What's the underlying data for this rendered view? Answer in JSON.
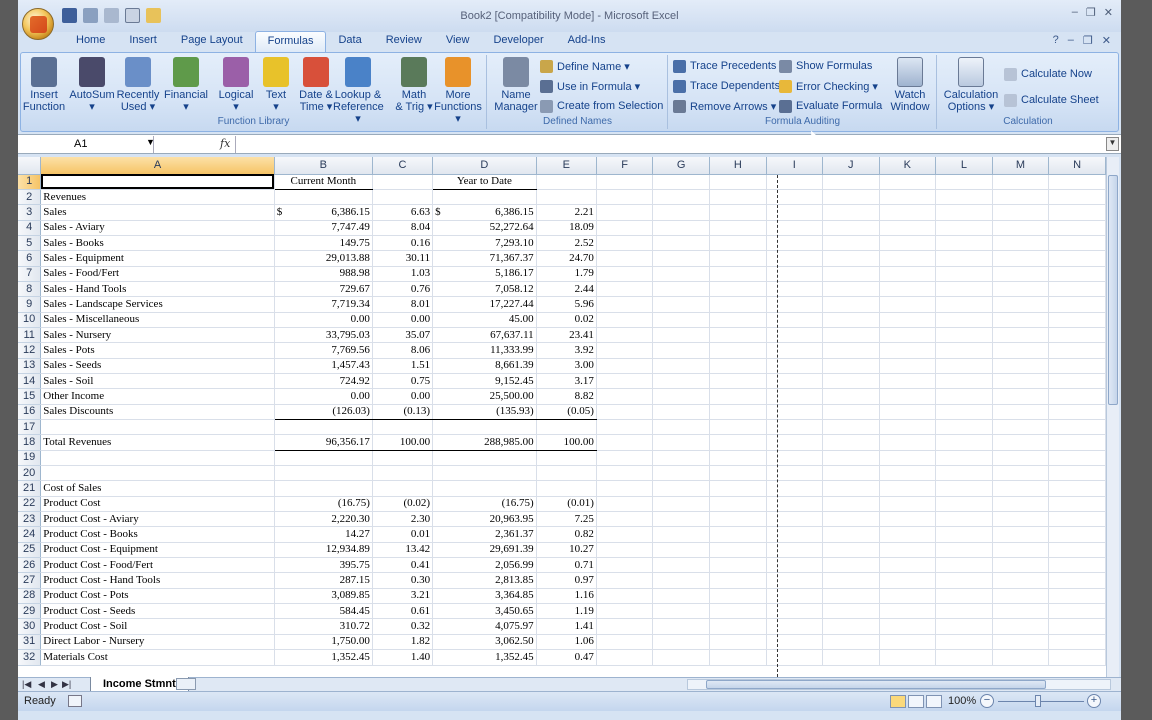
{
  "window": {
    "title": "Book2  [Compatibility Mode] - Microsoft Excel",
    "controls": [
      "–",
      "❐",
      "✕"
    ],
    "doc_controls": [
      "?",
      "–",
      "❐",
      "✕"
    ]
  },
  "qat": [
    "save-icon",
    "undo-icon",
    "redo-icon",
    "print-preview-icon",
    "open-icon"
  ],
  "tabs": [
    {
      "label": "Home"
    },
    {
      "label": "Insert"
    },
    {
      "label": "Page Layout"
    },
    {
      "label": "Formulas",
      "active": true
    },
    {
      "label": "Data"
    },
    {
      "label": "Review"
    },
    {
      "label": "View"
    },
    {
      "label": "Developer"
    },
    {
      "label": "Add-Ins"
    }
  ],
  "ribbon": {
    "function_library": {
      "label": "Function Library",
      "buttons": [
        {
          "line1": "Insert",
          "line2": "Function",
          "icon": "fx-icon",
          "color": "#5a6f93"
        },
        {
          "line1": "AutoSum",
          "line2": "▾",
          "icon": "sigma-icon",
          "color": "#4a4a6a"
        },
        {
          "line1": "Recently",
          "line2": "Used ▾",
          "icon": "star-book-icon",
          "color": "#6a8fc8"
        },
        {
          "line1": "Financial",
          "line2": "▾",
          "icon": "financial-book-icon",
          "color": "#5f9a4a"
        },
        {
          "line1": "Logical",
          "line2": "▾",
          "icon": "logical-book-icon",
          "color": "#9b5fa8"
        },
        {
          "line1": "Text",
          "line2": "▾",
          "icon": "text-book-icon",
          "color": "#e8c22a"
        },
        {
          "line1": "Date &",
          "line2": "Time ▾",
          "icon": "date-book-icon",
          "color": "#d8503a"
        },
        {
          "line1": "Lookup &",
          "line2": "Reference ▾",
          "icon": "lookup-book-icon",
          "color": "#4a82c8"
        },
        {
          "line1": "Math",
          "line2": "& Trig ▾",
          "icon": "math-book-icon",
          "color": "#5a7a5a"
        },
        {
          "line1": "More",
          "line2": "Functions ▾",
          "icon": "more-books-icon",
          "color": "#e8922a"
        }
      ]
    },
    "defined_names": {
      "label": "Defined Names",
      "big": {
        "line1": "Name",
        "line2": "Manager",
        "icon": "name-manager-icon"
      },
      "small": [
        "Define Name ▾",
        "Use in Formula ▾",
        "Create from Selection"
      ]
    },
    "formula_auditing": {
      "label": "Formula Auditing",
      "col1": [
        "Trace Precedents",
        "Trace Dependents",
        "Remove Arrows ▾"
      ],
      "col2": [
        "Show Formulas",
        "Error Checking ▾",
        "Evaluate Formula"
      ],
      "watch": {
        "line1": "Watch",
        "line2": "Window"
      }
    },
    "calculation": {
      "label": "Calculation",
      "big": {
        "line1": "Calculation",
        "line2": "Options ▾"
      },
      "small": [
        "Calculate Now",
        "Calculate Sheet"
      ]
    }
  },
  "formula_bar": {
    "name_box": "A1",
    "fx": "fx",
    "value": ""
  },
  "columns": [
    "A",
    "B",
    "C",
    "D",
    "E",
    "F",
    "G",
    "H",
    "I",
    "J",
    "K",
    "L",
    "M",
    "N"
  ],
  "rows": [
    {
      "n": "1",
      "a": "",
      "b": "Current Month",
      "c": "",
      "d": "Year to Date",
      "e": ""
    },
    {
      "n": "2",
      "a": "Revenues",
      "b": "",
      "c": "",
      "d": "",
      "e": ""
    },
    {
      "n": "3",
      "a": "Sales",
      "b": "6,386.15",
      "c": "6.63",
      "d": "6,386.15",
      "e": "2.21",
      "dollar": "$"
    },
    {
      "n": "4",
      "a": "Sales - Aviary",
      "b": "7,747.49",
      "c": "8.04",
      "d": "52,272.64",
      "e": "18.09"
    },
    {
      "n": "5",
      "a": "Sales - Books",
      "b": "149.75",
      "c": "0.16",
      "d": "7,293.10",
      "e": "2.52"
    },
    {
      "n": "6",
      "a": "Sales - Equipment",
      "b": "29,013.88",
      "c": "30.11",
      "d": "71,367.37",
      "e": "24.70"
    },
    {
      "n": "7",
      "a": "Sales - Food/Fert",
      "b": "988.98",
      "c": "1.03",
      "d": "5,186.17",
      "e": "1.79"
    },
    {
      "n": "8",
      "a": "Sales - Hand Tools",
      "b": "729.67",
      "c": "0.76",
      "d": "7,058.12",
      "e": "2.44"
    },
    {
      "n": "9",
      "a": "Sales - Landscape Services",
      "b": "7,719.34",
      "c": "8.01",
      "d": "17,227.44",
      "e": "5.96"
    },
    {
      "n": "10",
      "a": "Sales - Miscellaneous",
      "b": "0.00",
      "c": "0.00",
      "d": "45.00",
      "e": "0.02"
    },
    {
      "n": "11",
      "a": "Sales - Nursery",
      "b": "33,795.03",
      "c": "35.07",
      "d": "67,637.11",
      "e": "23.41"
    },
    {
      "n": "12",
      "a": "Sales - Pots",
      "b": "7,769.56",
      "c": "8.06",
      "d": "11,333.99",
      "e": "3.92"
    },
    {
      "n": "13",
      "a": "Sales - Seeds",
      "b": "1,457.43",
      "c": "1.51",
      "d": "8,661.39",
      "e": "3.00"
    },
    {
      "n": "14",
      "a": "Sales - Soil",
      "b": "724.92",
      "c": "0.75",
      "d": "9,152.45",
      "e": "3.17"
    },
    {
      "n": "15",
      "a": "Other Income",
      "b": "0.00",
      "c": "0.00",
      "d": "25,500.00",
      "e": "8.82"
    },
    {
      "n": "16",
      "a": "Sales Discounts",
      "b": "(126.03)",
      "c": "(0.13)",
      "d": "(135.93)",
      "e": "(0.05)",
      "underline": true
    },
    {
      "n": "17",
      "a": "",
      "b": "",
      "c": "",
      "d": "",
      "e": ""
    },
    {
      "n": "18",
      "a": "Total Revenues",
      "b": "96,356.17",
      "c": "100.00",
      "d": "288,985.00",
      "e": "100.00",
      "underline": true
    },
    {
      "n": "19",
      "a": "",
      "b": "",
      "c": "",
      "d": "",
      "e": ""
    },
    {
      "n": "20",
      "a": "",
      "b": "",
      "c": "",
      "d": "",
      "e": ""
    },
    {
      "n": "21",
      "a": "Cost of Sales",
      "b": "",
      "c": "",
      "d": "",
      "e": ""
    },
    {
      "n": "22",
      "a": "Product Cost",
      "b": "(16.75)",
      "c": "(0.02)",
      "d": "(16.75)",
      "e": "(0.01)"
    },
    {
      "n": "23",
      "a": "Product Cost - Aviary",
      "b": "2,220.30",
      "c": "2.30",
      "d": "20,963.95",
      "e": "7.25"
    },
    {
      "n": "24",
      "a": "Product Cost - Books",
      "b": "14.27",
      "c": "0.01",
      "d": "2,361.37",
      "e": "0.82"
    },
    {
      "n": "25",
      "a": "Product Cost - Equipment",
      "b": "12,934.89",
      "c": "13.42",
      "d": "29,691.39",
      "e": "10.27"
    },
    {
      "n": "26",
      "a": "Product Cost - Food/Fert",
      "b": "395.75",
      "c": "0.41",
      "d": "2,056.99",
      "e": "0.71"
    },
    {
      "n": "27",
      "a": "Product Cost - Hand Tools",
      "b": "287.15",
      "c": "0.30",
      "d": "2,813.85",
      "e": "0.97"
    },
    {
      "n": "28",
      "a": "Product Cost - Pots",
      "b": "3,089.85",
      "c": "3.21",
      "d": "3,364.85",
      "e": "1.16"
    },
    {
      "n": "29",
      "a": "Product Cost - Seeds",
      "b": "584.45",
      "c": "0.61",
      "d": "3,450.65",
      "e": "1.19"
    },
    {
      "n": "30",
      "a": "Product Cost - Soil",
      "b": "310.72",
      "c": "0.32",
      "d": "4,075.97",
      "e": "1.41"
    },
    {
      "n": "31",
      "a": "Direct Labor - Nursery",
      "b": "1,750.00",
      "c": "1.82",
      "d": "3,062.50",
      "e": "1.06"
    },
    {
      "n": "32",
      "a": "Materials Cost",
      "b": "1,352.45",
      "c": "1.40",
      "d": "1,352.45",
      "e": "0.47"
    }
  ],
  "sheet_tabs": [
    {
      "label": "Income Stmnt",
      "active": true
    }
  ],
  "status": {
    "text": "Ready",
    "zoom": "100%",
    "zoom_minus": "−",
    "zoom_plus": "+"
  }
}
